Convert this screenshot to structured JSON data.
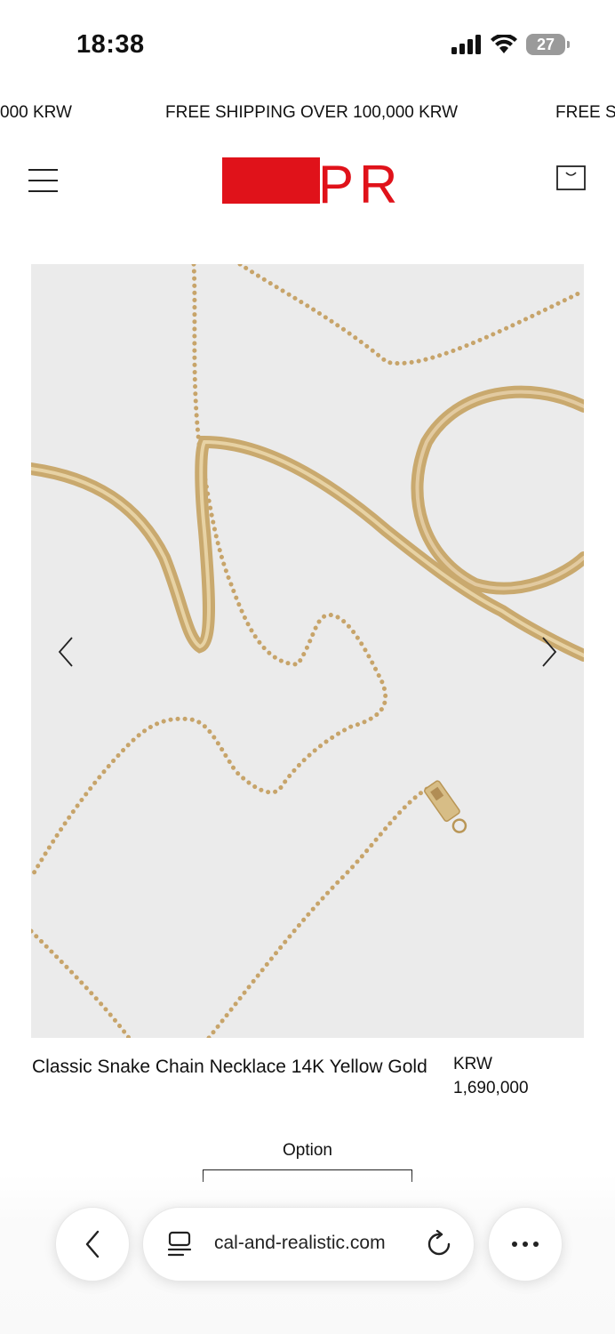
{
  "status_bar": {
    "time": "18:38",
    "battery": "27"
  },
  "announcement": {
    "text_left": "000 KRW",
    "text_center": "FREE SHIPPING OVER 100,000 KRW",
    "text_right": "FREE S"
  },
  "header": {
    "menu_icon": "hamburger-icon",
    "logo_text": "PR",
    "cart_icon": "shopping-bag-icon",
    "brand_color": "#e0121a"
  },
  "gallery": {
    "prev_icon": "chevron-left-icon",
    "next_icon": "chevron-right-icon",
    "background": "#ebebeb",
    "chain_color": "#c9a96e"
  },
  "product": {
    "title": "Classic Snake Chain Necklace 14K Yellow Gold",
    "price_currency": "KRW",
    "price_value": "1,690,000"
  },
  "options": {
    "label": "Option"
  },
  "browser": {
    "url": "cal-and-realistic.com",
    "back_icon": "chevron-left-icon",
    "reader_icon": "reader-icon",
    "reload_icon": "reload-icon",
    "more_icon": "more-icon"
  }
}
